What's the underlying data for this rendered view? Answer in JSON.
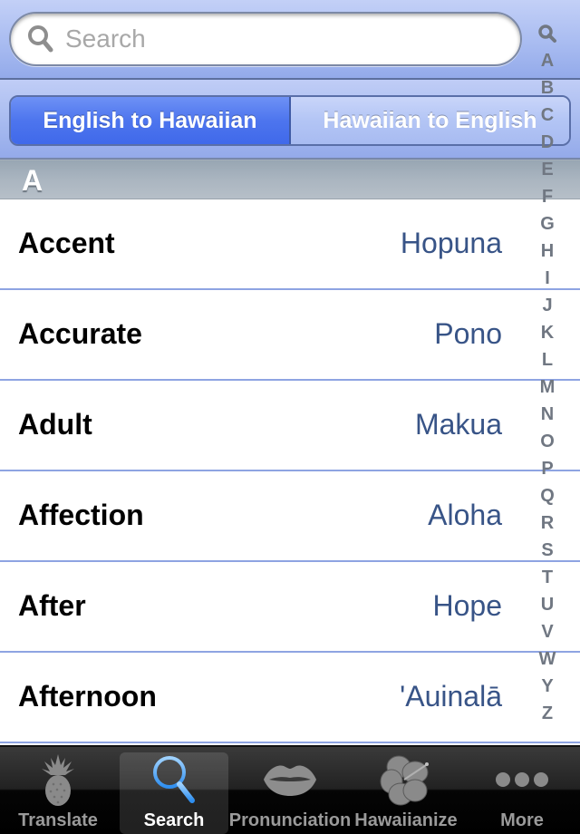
{
  "search": {
    "placeholder": "Search",
    "value": "",
    "icon": "magnifier-icon"
  },
  "direction_toggle": {
    "options": [
      {
        "label": "English to Hawaiian",
        "selected": true
      },
      {
        "label": "Hawaiian to English",
        "selected": false
      }
    ]
  },
  "section": {
    "title": "A"
  },
  "entries": [
    {
      "english": "Accent",
      "hawaiian": "Hopuna"
    },
    {
      "english": "Accurate",
      "hawaiian": "Pono"
    },
    {
      "english": "Adult",
      "hawaiian": "Makua"
    },
    {
      "english": "Affection",
      "hawaiian": "Aloha"
    },
    {
      "english": "After",
      "hawaiian": "Hope"
    },
    {
      "english": "Afternoon",
      "hawaiian": "'Auinalā"
    }
  ],
  "index": {
    "search_icon": "magnifier-icon",
    "letters": [
      "A",
      "B",
      "C",
      "D",
      "E",
      "F",
      "G",
      "H",
      "I",
      "J",
      "K",
      "L",
      "M",
      "N",
      "O",
      "P",
      "Q",
      "R",
      "S",
      "T",
      "U",
      "V",
      "W",
      "Y",
      "Z"
    ]
  },
  "tabs": [
    {
      "label": "Translate",
      "icon": "pineapple-icon",
      "active": false
    },
    {
      "label": "Search",
      "icon": "search-icon",
      "active": true
    },
    {
      "label": "Pronunciation",
      "icon": "lips-icon",
      "active": false
    },
    {
      "label": "Hawaiianize",
      "icon": "hibiscus-icon",
      "active": false
    },
    {
      "label": "More",
      "icon": "more-dots-icon",
      "active": false
    }
  ],
  "colors": {
    "accent_blue": "#4d75ee",
    "hawaiian_text": "#385487",
    "separator": "#8ea4e2",
    "index_text": "#707782"
  }
}
